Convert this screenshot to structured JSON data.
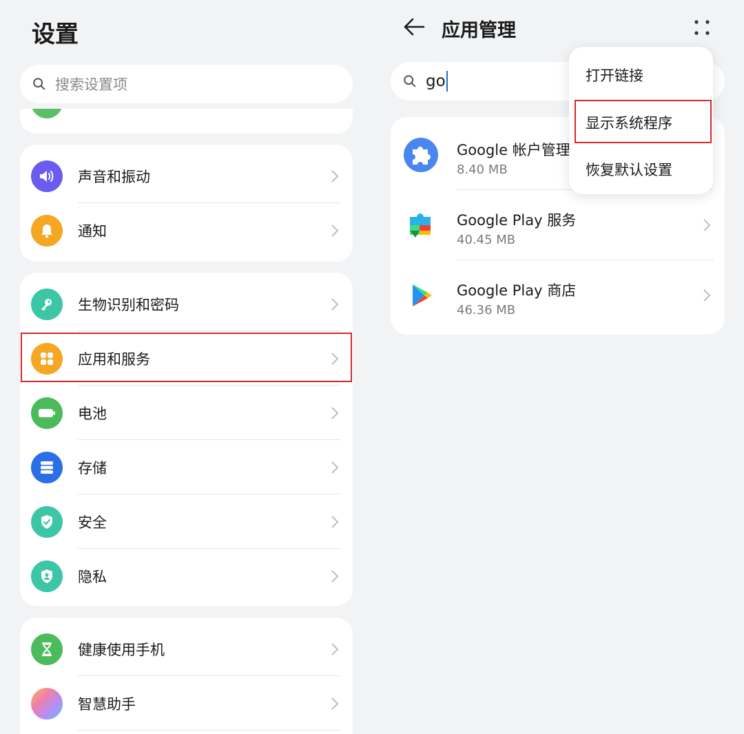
{
  "left": {
    "title": "设置",
    "search_placeholder": "搜索设置项",
    "groups": [
      {
        "items": [
          {
            "label": "声音和振动",
            "icon": "sound-icon",
            "color": "#6a5cf0"
          },
          {
            "label": "通知",
            "icon": "bell-icon",
            "color": "#f5a623"
          }
        ]
      },
      {
        "items": [
          {
            "label": "生物识别和密码",
            "icon": "key-icon",
            "color": "#3cc6a6"
          },
          {
            "label": "应用和服务",
            "icon": "apps-icon",
            "color": "#f5a623"
          },
          {
            "label": "电池",
            "icon": "battery-icon",
            "color": "#4cbb5c"
          },
          {
            "label": "存储",
            "icon": "storage-icon",
            "color": "#2a6ee8"
          },
          {
            "label": "安全",
            "icon": "shield-icon",
            "color": "#3cc6a6"
          },
          {
            "label": "隐私",
            "icon": "privacy-icon",
            "color": "#3cc6a6"
          }
        ]
      },
      {
        "items": [
          {
            "label": "健康使用手机",
            "icon": "hourglass-icon",
            "color": "#4cbb5c"
          },
          {
            "label": "智慧助手",
            "icon": "assistant-icon",
            "color": "#b58cf5"
          }
        ]
      }
    ]
  },
  "right": {
    "title": "应用管理",
    "search_value": "go",
    "apps": [
      {
        "name": "Google 帐户管理程序",
        "size": "8.40 MB",
        "icon": "puzzle-icon"
      },
      {
        "name": "Google Play 服务",
        "size": "40.45 MB",
        "icon": "play-services-icon"
      },
      {
        "name": "Google Play 商店",
        "size": "46.36 MB",
        "icon": "play-store-icon"
      }
    ],
    "menu": [
      "打开链接",
      "显示系统程序",
      "恢复默认设置"
    ]
  },
  "colors": {
    "highlight": "#d8262a",
    "accent": "#1f6bd9",
    "background": "#f1f3f5"
  }
}
